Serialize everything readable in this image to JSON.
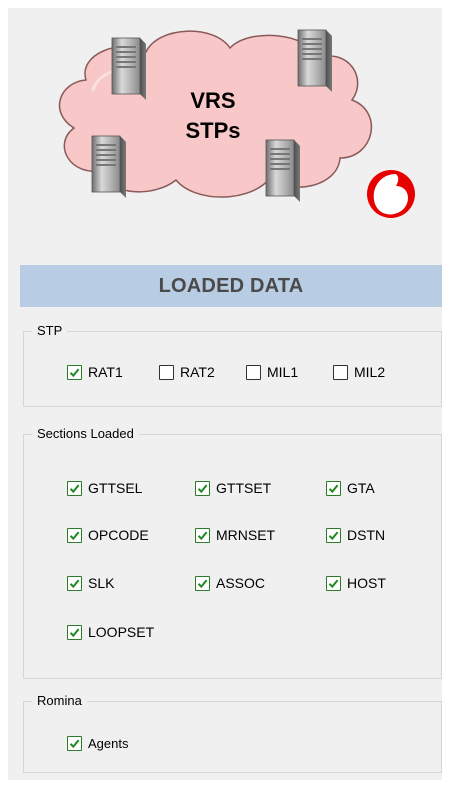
{
  "hero": {
    "cloud_line1": "VRS",
    "cloud_line2": "STPs",
    "brand_color": "#e60000",
    "cloud_color": "#f9c8c8"
  },
  "banner": {
    "title": "LOADED DATA"
  },
  "stp_group": {
    "legend": "STP",
    "items": [
      {
        "label": "RAT1",
        "checked": true
      },
      {
        "label": "RAT2",
        "checked": false
      },
      {
        "label": "MIL1",
        "checked": false
      },
      {
        "label": "MIL2",
        "checked": false
      }
    ]
  },
  "sections_group": {
    "legend": "Sections Loaded",
    "items": [
      {
        "label": "GTTSEL",
        "checked": true
      },
      {
        "label": "GTTSET",
        "checked": true
      },
      {
        "label": "GTA",
        "checked": true
      },
      {
        "label": "OPCODE",
        "checked": true
      },
      {
        "label": "MRNSET",
        "checked": true
      },
      {
        "label": "DSTN",
        "checked": true
      },
      {
        "label": "SLK",
        "checked": true
      },
      {
        "label": "ASSOC",
        "checked": true
      },
      {
        "label": "HOST",
        "checked": true
      },
      {
        "label": "LOOPSET",
        "checked": true
      }
    ]
  },
  "romina_group": {
    "legend": "Romina",
    "items": [
      {
        "label": "Agents",
        "checked": true
      }
    ]
  }
}
